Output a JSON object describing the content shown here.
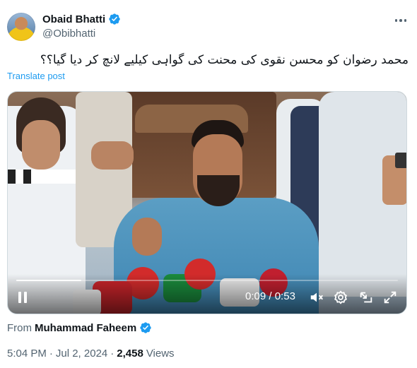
{
  "author": {
    "display_name": "Obaid Bhatti",
    "handle": "@Obibhatti",
    "verified": true
  },
  "tweet": {
    "text": "محمد رضوان کو محسن نقوی کی محنت کی گواہی کیلیے لانچ کر دیا گیا؟؟",
    "translate_label": "Translate post"
  },
  "video": {
    "current_time": "0:09",
    "duration": "0:53",
    "time_separator": " / ",
    "progress": 0.17,
    "state": "playing"
  },
  "source": {
    "prefix": "From",
    "name": "Muhammad Faheem",
    "verified": true
  },
  "meta": {
    "time": "5:04 PM",
    "date": "Jul 2, 2024",
    "separator": "·",
    "views_count": "2,458",
    "views_label": "Views"
  },
  "colors": {
    "accent": "#1d9bf0",
    "secondary_text": "#536471",
    "primary_text": "#0f1419"
  },
  "icons": [
    "verified-badge-icon",
    "more-icon",
    "pause-icon",
    "mute-icon",
    "settings-icon",
    "pip-icon",
    "fullscreen-icon"
  ]
}
